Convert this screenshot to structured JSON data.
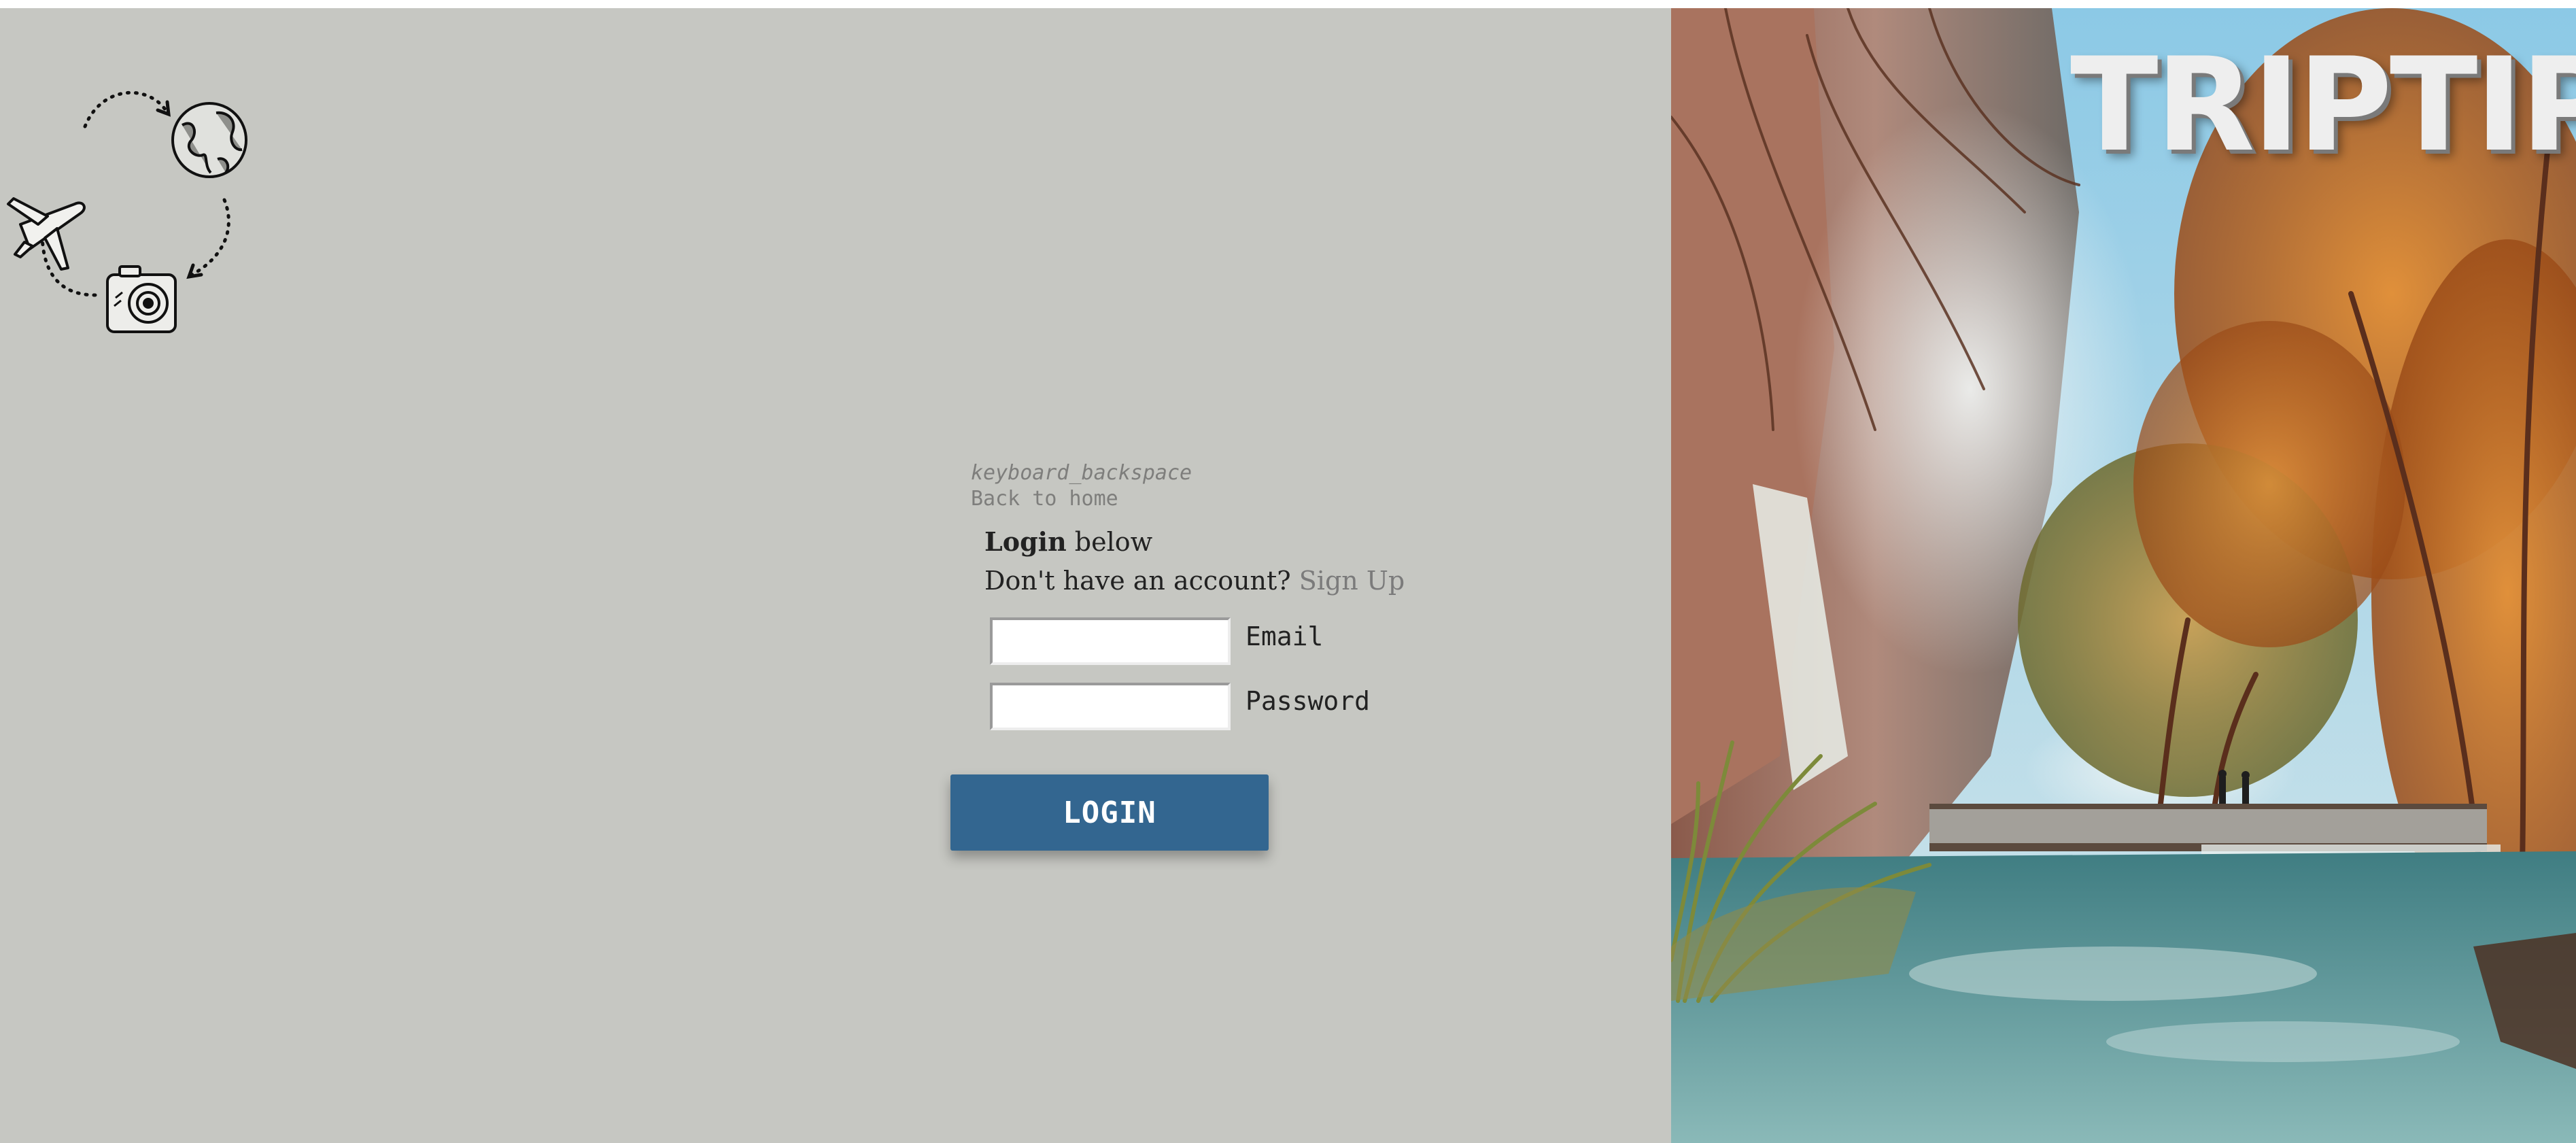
{
  "back": {
    "icon_text": "keyboard_backspace",
    "label": "Back to home"
  },
  "login": {
    "heading_bold": "Login",
    "heading_rest": " below",
    "signup_prompt": "Don't have an account? ",
    "signup_link": "Sign Up",
    "email_label": "Email",
    "password_label": "Password",
    "email_value": "",
    "password_value": "",
    "button_label": "LOGIN"
  },
  "brand": {
    "title": "TRIPTIPS"
  },
  "colors": {
    "panel_background": "#c6c7c2",
    "button": "#336690",
    "link_muted": "#7b7b7b"
  },
  "icons": {
    "logo": "travel-cycle-logo",
    "logo_parts": [
      "airplane-icon",
      "globe-icon",
      "camera-icon"
    ]
  }
}
